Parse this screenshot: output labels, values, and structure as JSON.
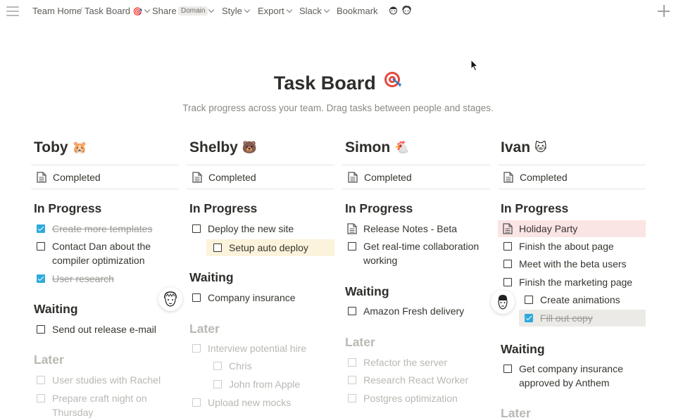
{
  "topbar": {
    "breadcrumb_home": "Team Home",
    "breadcrumb_sep": "/",
    "breadcrumb_page": "Task Board",
    "page_emoji": "🎯",
    "share": "Share",
    "share_badge": "Domain",
    "style": "Style",
    "export": "Export",
    "slack": "Slack",
    "bookmark": "Bookmark"
  },
  "page": {
    "title": "Task Board",
    "title_emoji": "🎯",
    "subtitle": "Track progress across your team.  Drag tasks between people and stages."
  },
  "columns": [
    {
      "name": "Toby",
      "emoji": "🐹",
      "completed": "Completed",
      "in_progress_label": "In Progress",
      "waiting_label": "Waiting",
      "later_label": "Later",
      "in_progress": [
        {
          "text": "Create more templates",
          "checked": true
        },
        {
          "text": "Contact Dan about the compiler optimization",
          "checked": false
        },
        {
          "text": "User research",
          "checked": true
        }
      ],
      "waiting": [
        {
          "text": "Send out release e-mail",
          "checked": false
        }
      ],
      "later": [
        {
          "text": "User studies with Rachel",
          "checked": false
        },
        {
          "text": "Prepare craft night on Thursday",
          "checked": false
        }
      ]
    },
    {
      "name": "Shelby",
      "emoji": "🐻",
      "completed": "Completed",
      "in_progress_label": "In Progress",
      "waiting_label": "Waiting",
      "later_label": "Later",
      "in_progress": [
        {
          "text": "Deploy the new site",
          "checked": false
        },
        {
          "text": "Setup auto deploy",
          "checked": false
        }
      ],
      "waiting": [
        {
          "text": "Company insurance",
          "checked": false
        }
      ],
      "later": [
        {
          "text": "Interview potential hire",
          "checked": false
        },
        {
          "text": "Chris",
          "checked": false
        },
        {
          "text": "John from Apple",
          "checked": false
        },
        {
          "text": "Upload new mocks",
          "checked": false
        }
      ]
    },
    {
      "name": "Simon",
      "emoji": "🐔",
      "completed": "Completed",
      "in_progress_label": "In Progress",
      "waiting_label": "Waiting",
      "later_label": "Later",
      "in_progress": [
        {
          "text": "Release Notes - Beta",
          "checked": false
        },
        {
          "text": "Get real-time collaboration working",
          "checked": false
        }
      ],
      "waiting": [
        {
          "text": "Amazon Fresh delivery",
          "checked": false
        }
      ],
      "later": [
        {
          "text": "Refactor the server",
          "checked": false
        },
        {
          "text": "Research React Worker",
          "checked": false
        },
        {
          "text": "Postgres optimization",
          "checked": false
        }
      ]
    },
    {
      "name": "Ivan",
      "emoji": "🐱",
      "completed": "Completed",
      "in_progress_label": "In Progress",
      "waiting_label": "Waiting",
      "later_label": "Later",
      "in_progress": [
        {
          "text": "Holiday Party",
          "checked": false
        },
        {
          "text": "Finish the about page",
          "checked": false
        },
        {
          "text": "Meet with the beta users",
          "checked": false
        },
        {
          "text": "Finish the marketing page",
          "checked": false
        },
        {
          "text": "Create animations",
          "checked": false
        },
        {
          "text": "Fill out copy",
          "checked": true
        }
      ],
      "waiting": [
        {
          "text": "Get company insurance approved by Anthem",
          "checked": false
        }
      ]
    }
  ],
  "colors": {
    "accent_check": "#2eaadc",
    "highlight_yellow": "#fbf3db",
    "highlight_red": "#fbe4e4",
    "highlight_gray": "#ebeae7"
  }
}
